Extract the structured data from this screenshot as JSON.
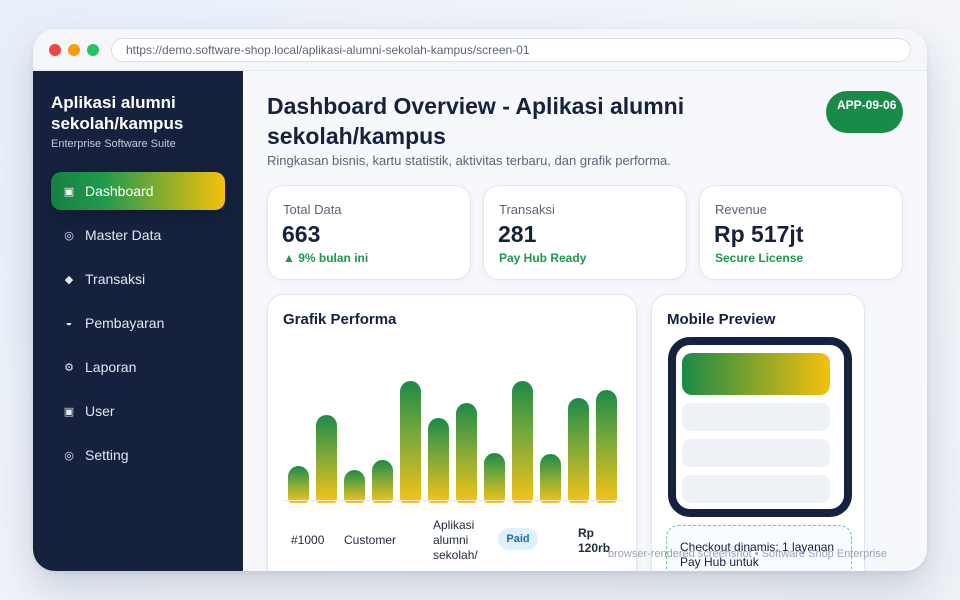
{
  "browser": {
    "url": "https://demo.software-shop.local/aplikasi-alumni-sekolah-kampus/screen-01"
  },
  "sidebar": {
    "brand_title": "Aplikasi alumni sekolah/kampus",
    "brand_subtitle": "Enterprise Software Suite",
    "items": [
      {
        "label": "Dashboard",
        "icon": "▣",
        "icon_name": "dashboard-icon",
        "active": true
      },
      {
        "label": "Master Data",
        "icon": "◎",
        "icon_name": "master-data-icon",
        "active": false
      },
      {
        "label": "Transaksi",
        "icon": "◆",
        "icon_name": "transaksi-icon",
        "active": false
      },
      {
        "label": "Pembayaran",
        "icon": "◒",
        "icon_name": "pembayaran-icon",
        "active": false
      },
      {
        "label": "Laporan",
        "icon": "⚙",
        "icon_name": "laporan-icon",
        "active": false
      },
      {
        "label": "User",
        "icon": "▣",
        "icon_name": "user-icon",
        "active": false
      },
      {
        "label": "Setting",
        "icon": "◎",
        "icon_name": "setting-icon",
        "active": false
      }
    ]
  },
  "header": {
    "title": "Dashboard Overview - Aplikasi alumni sekolah/kampus",
    "subtitle": "Ringkasan bisnis, kartu statistik, aktivitas terbaru, dan grafik performa.",
    "badge": "APP-09-06"
  },
  "stats": [
    {
      "label": "Total Data",
      "value": "663",
      "note": "▲ 9% bulan ini"
    },
    {
      "label": "Transaksi",
      "value": "281",
      "note": "Pay Hub Ready"
    },
    {
      "label": "Revenue",
      "value": "Rp 517jt",
      "note": "Secure License"
    }
  ],
  "chart": {
    "title": "Grafik Performa",
    "chart_data": {
      "type": "bar",
      "values": [
        30,
        72,
        27,
        35,
        100,
        70,
        82,
        41,
        100,
        40,
        86,
        93
      ]
    }
  },
  "table_row": {
    "id": "#1000",
    "customer": "Customer",
    "product": "Aplikasi alumni sekolah/",
    "status": "Paid",
    "amount": "Rp 120rb"
  },
  "mobile": {
    "title": "Mobile Preview",
    "checkout_text": "Checkout dinamis: 1 layanan Pay Hub untuk"
  },
  "footer": {
    "watermark": "browser-rendered screenshot • Software Shop Enterprise"
  },
  "colors": {
    "accent_green": "#1a8a48",
    "accent_yellow": "#f6c00c",
    "sidebar_bg": "#15213d"
  }
}
